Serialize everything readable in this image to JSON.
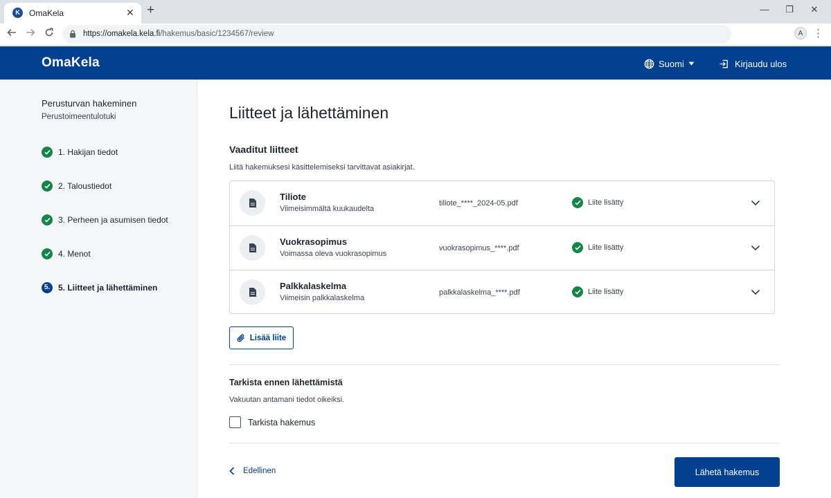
{
  "browser": {
    "tab_title": "OmaKela",
    "favicon_letter": "K",
    "url_host": "https://omakela.kela.fi",
    "url_path": "/hakemus/basic/1234567/review",
    "profile_initial": "A"
  },
  "header": {
    "logo": "OmaKela",
    "language": "Suomi",
    "logout": "Kirjaudu ulos",
    "brand_color": "#013f8f"
  },
  "sidebar": {
    "title": "Perusturvan hakeminen",
    "subtitle": "Perustoimeentulotuki",
    "steps": [
      {
        "label": "1. Hakijan tiedot",
        "status": "done"
      },
      {
        "label": "2. Taloustiedot",
        "status": "done"
      },
      {
        "label": "3. Perheen ja asumisen tiedot",
        "status": "done"
      },
      {
        "label": "4. Menot",
        "status": "done"
      },
      {
        "label": "5. Liitteet ja lähettäminen",
        "status": "current",
        "number": "5."
      }
    ]
  },
  "main": {
    "title": "Liitteet ja lähettäminen",
    "required_title": "Vaaditut liitteet",
    "required_desc": "Liitä hakemuksesi käsittelemiseksi tarvittavat asiakirjat.",
    "attachments": [
      {
        "name": "Tiliote",
        "desc": "Viimeisimmältä kuukaudelta",
        "file": "tiliote_****_2024-05.pdf",
        "status": "Liite lisätty"
      },
      {
        "name": "Vuokrasopimus",
        "desc": "Voimassa oleva vuokrasopimus",
        "file": "vuokrasopimus_****.pdf",
        "status": "Liite lisätty"
      },
      {
        "name": "Palkkalaskelma",
        "desc": "Viimeisin palkkalaskelma",
        "file": "palkkalaskelma_****.pdf",
        "status": "Liite lisätty"
      }
    ],
    "add_button": "Lisää liite",
    "confirm_title": "Tarkista ennen lähettämistä",
    "confirm_desc": "Vakuutan antamani tiedot oikeiksi.",
    "checkbox_label": "Tarkista hakemus",
    "checkbox_checked": false,
    "prev_button": "Edellinen",
    "submit_button": "Lähetä hakemus",
    "success_color": "#148548"
  }
}
